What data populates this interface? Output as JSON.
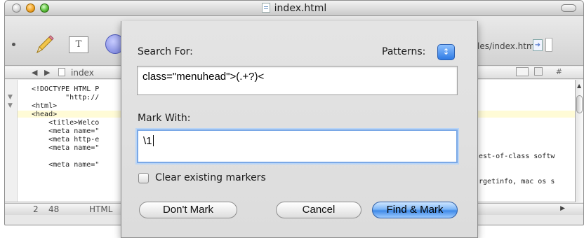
{
  "window": {
    "title": "index.html"
  },
  "toolbar": {
    "text_tool_label": "T",
    "path_text": "les/index.html"
  },
  "navbar": {
    "back": "◀",
    "forward": "▶",
    "filename": "index",
    "hash": "#"
  },
  "editor": {
    "lines": [
      "<!DOCTYPE HTML P",
      "        \"http://",
      "<html>",
      "<head>",
      "    <title>Welco",
      "    <meta name=\"",
      "    <meta http-e",
      "    <meta name=\"",
      "",
      "    <meta name=\""
    ],
    "right_fragment_1": "est-of-class softw",
    "right_fragment_2": "rgetinfo, mac os s"
  },
  "status": {
    "line": "2",
    "col": "48",
    "mode": "HTML"
  },
  "dialog": {
    "search_label": "Search For:",
    "patterns_label": "Patterns:",
    "search_value": "class=\"menuhead\">(.+?)<",
    "mark_label": "Mark With:",
    "mark_value": "\\1",
    "clear_label": "Clear existing markers",
    "clear_checked": false,
    "buttons": {
      "dont_mark": "Don't Mark",
      "cancel": "Cancel",
      "find_mark": "Find & Mark"
    }
  },
  "colors": {
    "accent": "#3f8ae8",
    "focus_ring": "#7aa8e6"
  }
}
